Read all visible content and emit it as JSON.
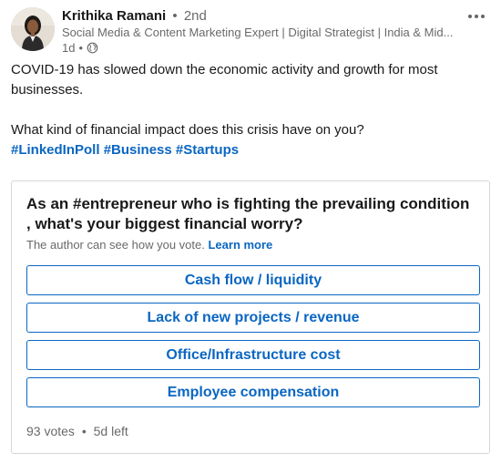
{
  "author": {
    "name": "Krithika Ramani",
    "separator": "•",
    "degree": "2nd",
    "headline": "Social Media & Content Marketing Expert | Digital Strategist | India & Mid...",
    "time": "1d",
    "visibility_icon": "globe-icon"
  },
  "post": {
    "paragraph1": "COVID-19 has slowed down the economic activity and growth for most businesses.",
    "paragraph2": "What kind of financial impact does this crisis have on you?",
    "hashtags": [
      "#LinkedInPoll",
      "#Business",
      "#Startups"
    ]
  },
  "poll": {
    "question": "As an #entrepreneur who is fighting the prevailing condition , what's your biggest financial worry?",
    "note": "The author can see how you vote.",
    "learn_more": "Learn more",
    "options": [
      "Cash flow / liquidity",
      "Lack of new projects / revenue",
      "Office/Infrastructure cost",
      "Employee compensation"
    ],
    "votes": "93 votes",
    "separator": "•",
    "time_left": "5d left"
  },
  "colors": {
    "accent": "#0a66c2",
    "text_secondary": "#666666",
    "border": "#d6d6d6"
  }
}
